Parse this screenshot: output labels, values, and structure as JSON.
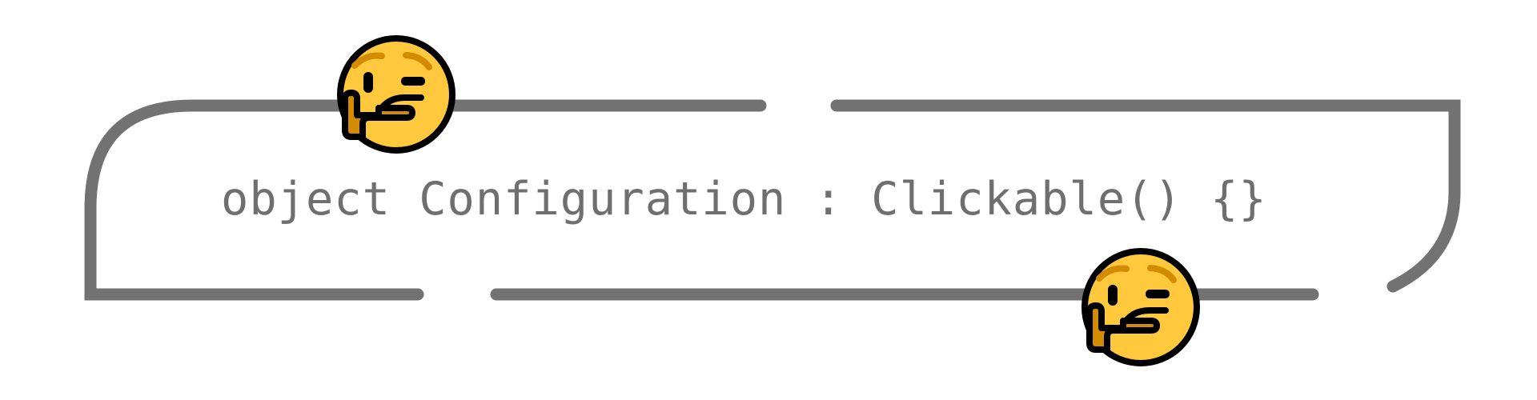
{
  "code": {
    "line": "object Configuration : Clickable() {}"
  },
  "decorations": {
    "emoji": "thinking-face-icon",
    "frame_color": "#727272",
    "emoji_fill": "#ffc83d",
    "emoji_hand": "#d38b00"
  }
}
